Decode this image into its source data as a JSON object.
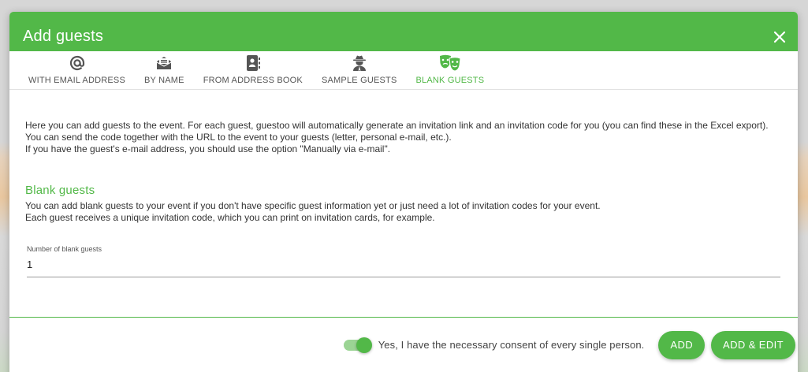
{
  "dialog": {
    "title": "Add guests"
  },
  "tabs": [
    {
      "label": "WITH EMAIL ADDRESS",
      "icon": "at-icon"
    },
    {
      "label": "BY NAME",
      "icon": "envelope-icon"
    },
    {
      "label": "FROM ADDRESS BOOK",
      "icon": "address-book-icon"
    },
    {
      "label": "SAMPLE GUESTS",
      "icon": "user-secret-icon"
    },
    {
      "label": "BLANK GUESTS",
      "icon": "masks-icon",
      "active": true
    }
  ],
  "intro": {
    "line1": "Here you can add guests to the event. For each guest, guestoo will automatically generate an invitation link and an invitation code for you (you can find these in the Excel export). You can send the code together with the URL to the event to your guests (letter, personal e-mail, etc.).",
    "line2": "If you have the guest's e-mail address, you should use the option \"Manually via e-mail\"."
  },
  "section": {
    "title": "Blank guests",
    "desc1": "You can add blank guests to your event if you don't have specific guest information yet or just need a lot of invitation codes for your event.",
    "desc2": "Each guest receives a unique invitation code, which you can print on invitation cards, for example."
  },
  "field": {
    "label": "Number of blank guests",
    "value": "1"
  },
  "footer": {
    "consent_label": "Yes, I have the necessary consent of every single person.",
    "consent_checked": true,
    "add_label": "ADD",
    "add_edit_label": "ADD & EDIT"
  },
  "colors": {
    "accent": "#52b848",
    "text": "#333333"
  }
}
